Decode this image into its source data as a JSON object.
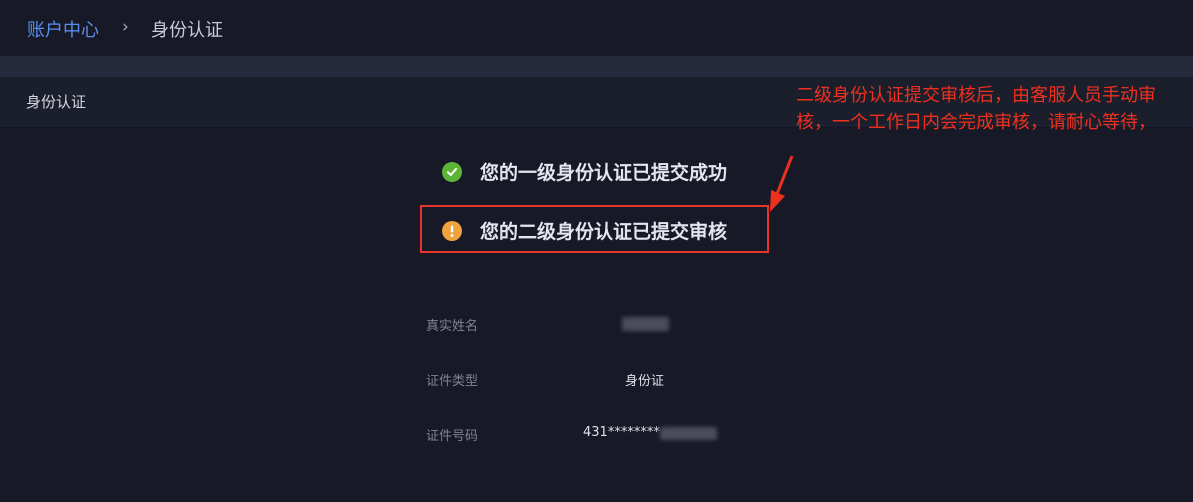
{
  "breadcrumb": {
    "root": "账户中心",
    "separator": "›",
    "current": "身份认证"
  },
  "section": {
    "title": "身份认证"
  },
  "status": {
    "level1": "您的一级身份认证已提交成功",
    "level2": "您的二级身份认证已提交审核"
  },
  "annotation": {
    "text": "二级身份认证提交审核后，由客服人员手动审核，一个工作日内会完成审核，请耐心等待，"
  },
  "fields": {
    "name_label": "真实姓名",
    "name_value": "",
    "idtype_label": "证件类型",
    "idtype_value": "身份证",
    "idnum_label": "证件号码",
    "idnum_value": "431********"
  },
  "colors": {
    "accent": "#5b8def",
    "success": "#5cb536",
    "warning": "#f0a33d",
    "annotation": "#f0301f"
  },
  "icons": {
    "success": "check-circle-icon",
    "warning": "exclamation-circle-icon"
  }
}
